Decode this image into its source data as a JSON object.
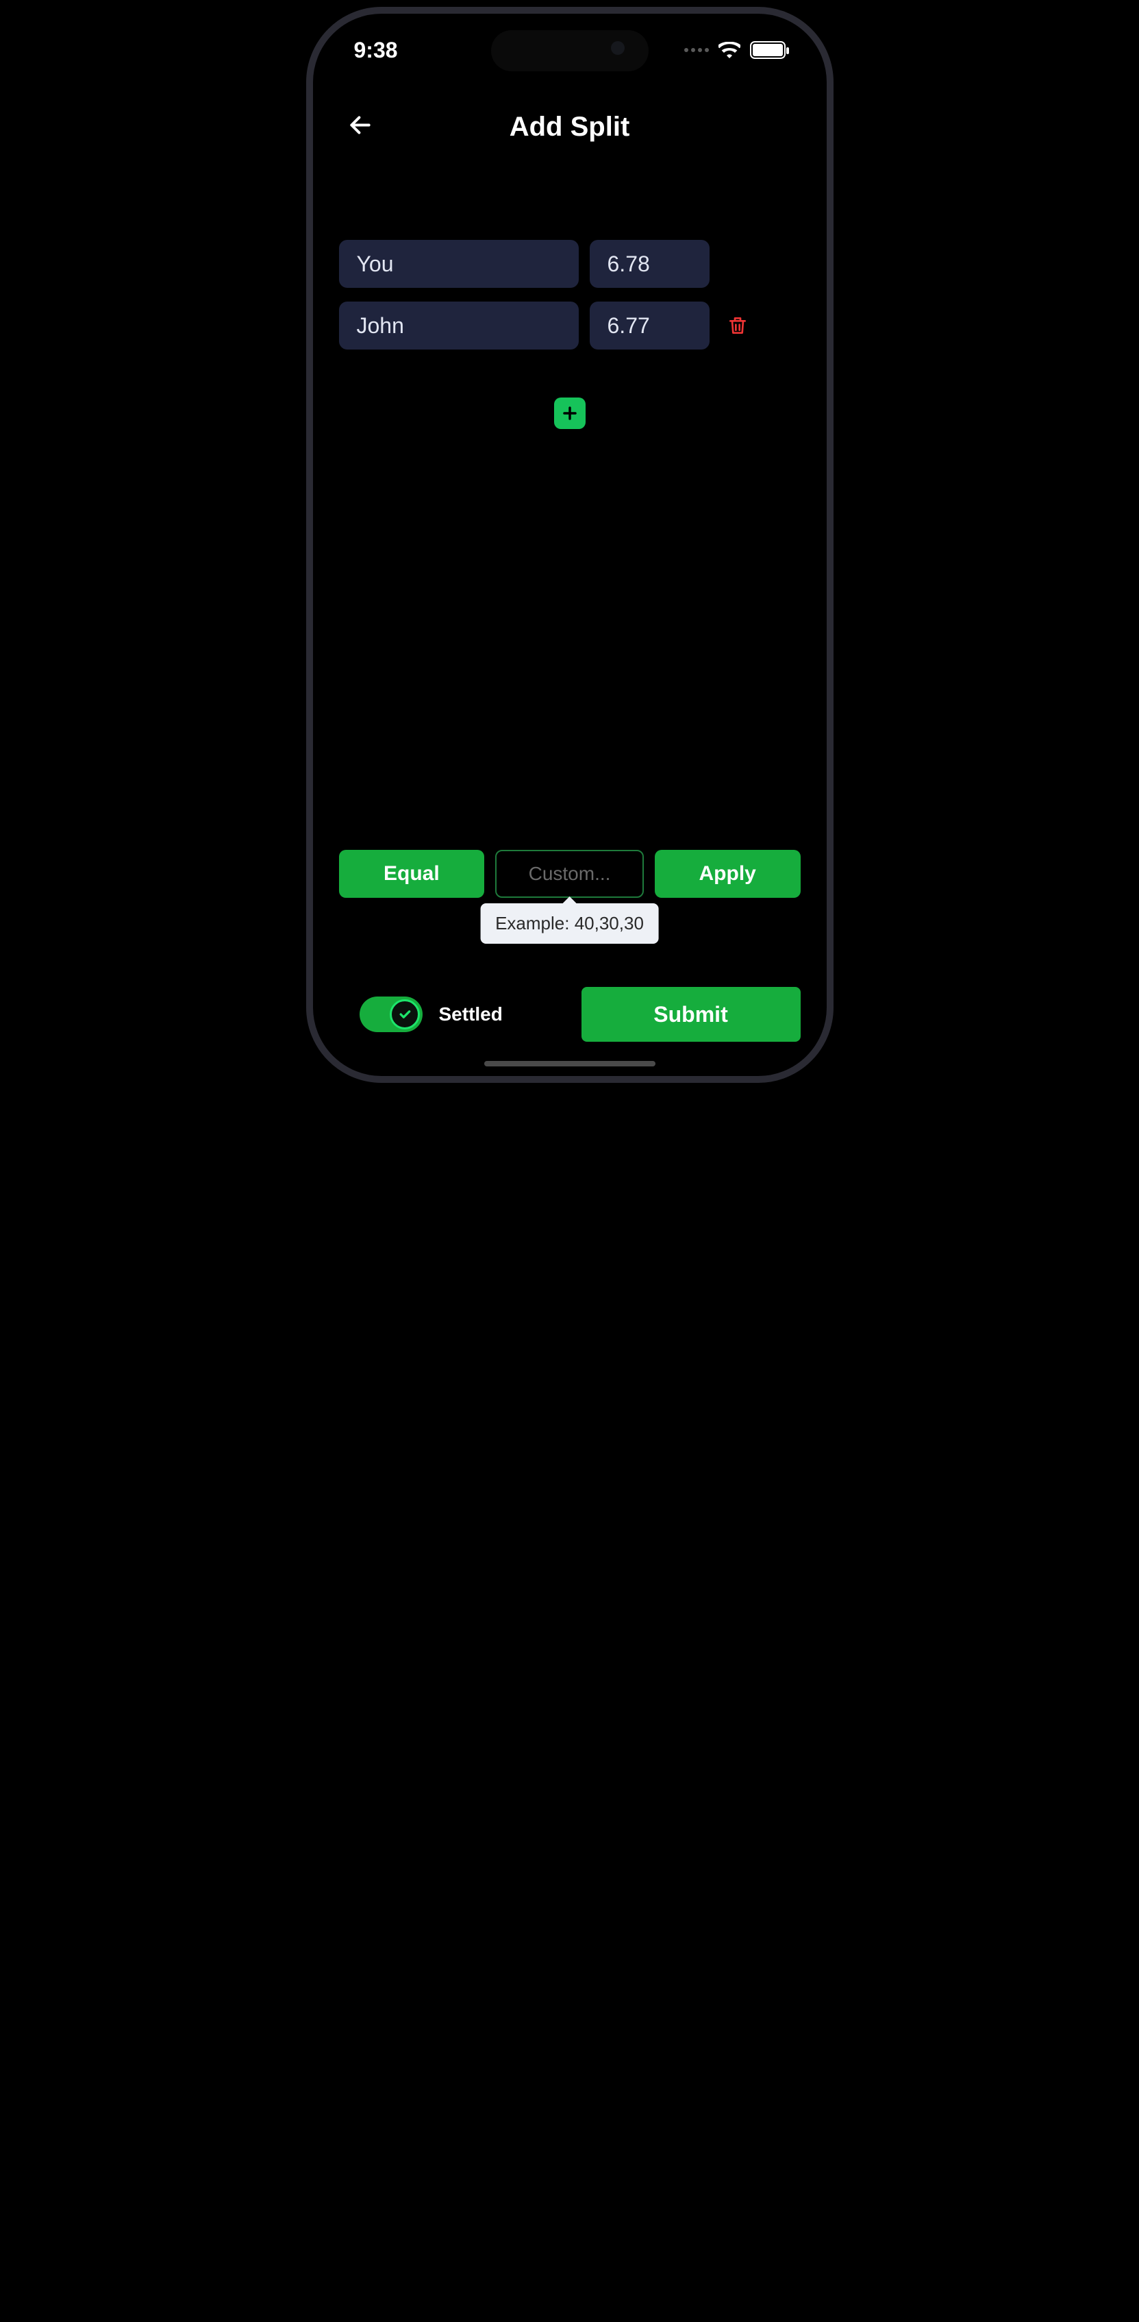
{
  "status": {
    "time": "9:38"
  },
  "header": {
    "title": "Add Split"
  },
  "participants": [
    {
      "name": "You",
      "amount": "6.78",
      "removable": false
    },
    {
      "name": "John",
      "amount": "6.77",
      "removable": true
    }
  ],
  "controls": {
    "equal_label": "Equal",
    "custom_placeholder": "Custom...",
    "apply_label": "Apply",
    "tooltip": "Example: 40,30,30"
  },
  "settled": {
    "label": "Settled",
    "value": true
  },
  "submit": {
    "label": "Submit"
  }
}
